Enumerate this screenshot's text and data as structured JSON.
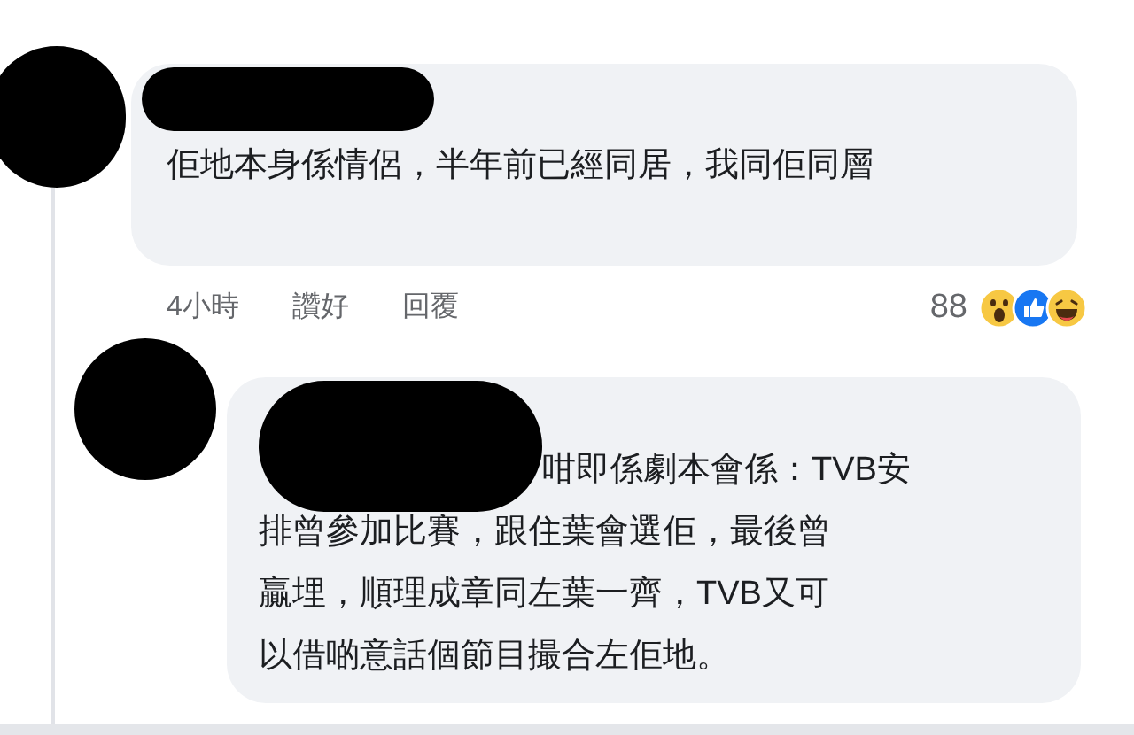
{
  "comments": [
    {
      "author": {
        "redacted": true
      },
      "text": "佢地本身係情侶，半年前已經同居，我同佢同層",
      "time": "4小時",
      "actions": [
        "讚好",
        "回覆"
      ],
      "reaction_count": "88"
    },
    {
      "author": {
        "redacted": true
      },
      "text_lines": [
        "咁即係劇本會係：TVB安",
        "排曾參加比賽，跟住葉會選佢，最後曾",
        "贏埋，順理成章同左葉一齊，TVB又可",
        "以借啲意話個節目撮合左佢地。"
      ]
    }
  ]
}
